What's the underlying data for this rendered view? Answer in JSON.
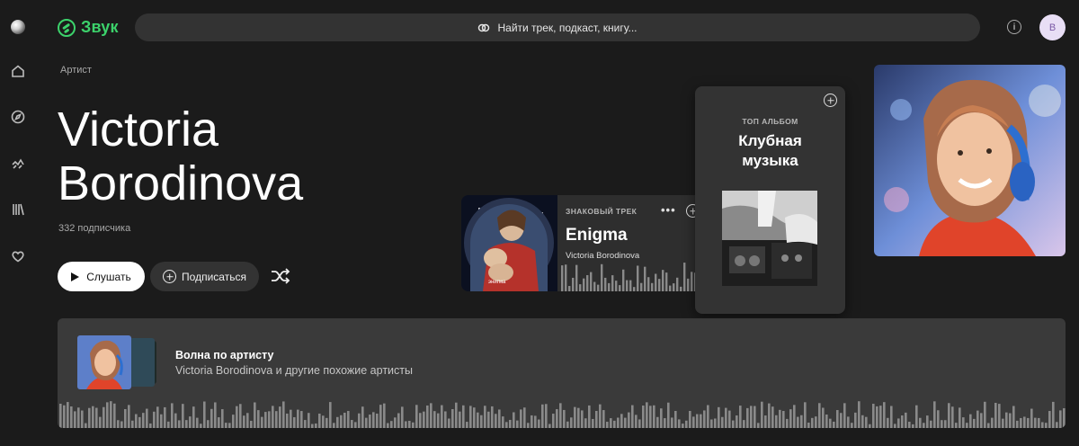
{
  "app": {
    "brand": "Звук",
    "accent_color": "#3cd26b"
  },
  "search": {
    "placeholder": "Найти трек, подкаст, книгу..."
  },
  "user": {
    "avatar_letter": "В"
  },
  "rail": {
    "icons": [
      "sphere-logo-icon",
      "home-icon",
      "compass-icon",
      "mic-icon",
      "library-icon",
      "heart-icon"
    ]
  },
  "artist": {
    "kicker": "Артист",
    "name_line1": "Victoria",
    "name_line2": "Borodinova",
    "subscribers": "332 подписчика"
  },
  "actions": {
    "listen": "Слушать",
    "subscribe": "Подписаться"
  },
  "signature_track": {
    "kicker": "ЗНАКОВЫЙ ТРЕК",
    "title": "Enigma",
    "artist": "Victoria Borodinova",
    "more": "•••"
  },
  "top_album": {
    "kicker": "ТОП АЛЬБОМ",
    "title_line1": "Клубная",
    "title_line2": "музыка"
  },
  "wave": {
    "title": "Волна по артисту",
    "subtitle": "Victoria Borodinova и другие похожие артисты"
  }
}
